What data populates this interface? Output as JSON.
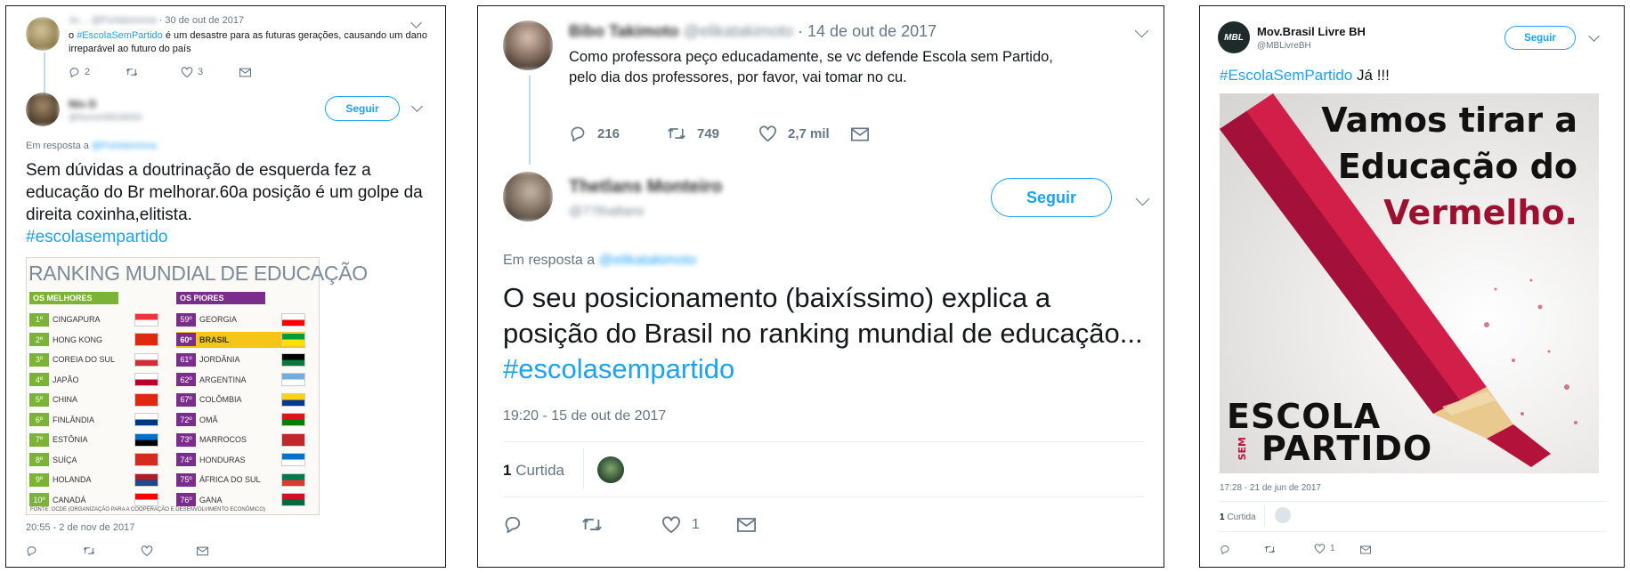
{
  "panel1": {
    "top_tweet": {
      "name": "Ju…",
      "handle": "@Fortalomnna",
      "date": "· 30 de out de 2017",
      "text_prefix": "o ",
      "hashtag": "#EscolaSemPartido",
      "text_suffix": " é um desastre para as futuras gerações, causando um dano irreparável ao futuro do país",
      "reply_count": "2",
      "like_count": "3"
    },
    "reply": {
      "name": "Nío D",
      "handle": "@NonoHMIO8000",
      "follow_label": "Seguir",
      "reply_prefix": "Em resposta a",
      "reply_to": "@Fortolomnna",
      "text": "Sem dúvidas a doutrinação de esquerda fez a educação do Br melhorar.60a posição é um golpe da direita coxinha,elitista.",
      "hashtag": "#escolasempartido",
      "timestamp": "20:55 - 2 de nov de 2017"
    },
    "ranking": {
      "title": "RANKING MUNDIAL DE EDUCAÇÃO",
      "best_label": "OS MELHORES",
      "worst_label": "OS PIORES",
      "best": [
        {
          "pos": "1º",
          "country": "CINGAPURA"
        },
        {
          "pos": "2º",
          "country": "HONG KONG"
        },
        {
          "pos": "3º",
          "country": "COREIA DO SUL"
        },
        {
          "pos": "4º",
          "country": "JAPÃO"
        },
        {
          "pos": "5º",
          "country": "CHINA"
        },
        {
          "pos": "6º",
          "country": "FINLÂNDIA"
        },
        {
          "pos": "7º",
          "country": "ESTÔNIA"
        },
        {
          "pos": "8º",
          "country": "SUÍÇA"
        },
        {
          "pos": "9º",
          "country": "HOLANDA"
        },
        {
          "pos": "10º",
          "country": "CANADÁ"
        }
      ],
      "worst": [
        {
          "pos": "59º",
          "country": "GEORGIA"
        },
        {
          "pos": "60º",
          "country": "BRASIL"
        },
        {
          "pos": "61º",
          "country": "JORDÂNIA"
        },
        {
          "pos": "62º",
          "country": "ARGENTINA"
        },
        {
          "pos": "67º",
          "country": "COLÔMBIA"
        },
        {
          "pos": "72º",
          "country": "OMÃ"
        },
        {
          "pos": "73º",
          "country": "MARROCOS"
        },
        {
          "pos": "74º",
          "country": "HONDURAS"
        },
        {
          "pos": "75º",
          "country": "ÁFRICA DO SUL"
        },
        {
          "pos": "76º",
          "country": "GANA"
        }
      ],
      "note": "FONTE: OCDE (ORGANIZAÇÃO PARA A COOPERAÇÃO E DESENVOLVIMENTO ECONÔMICO)"
    }
  },
  "panel2": {
    "top_tweet": {
      "name": "Bibo Takimoto",
      "handle": "@elikatakimoto",
      "date": "· 14 de out de 2017",
      "text": "Como professora peço educadamente, se vc defende Escola sem Partido, pelo dia dos professores, por favor, vai tomar no cu.",
      "reply_count": "216",
      "retweet_count": "749",
      "like_count": "2,7 mil"
    },
    "reply": {
      "name": "Thetlans Monteiro",
      "handle": "@77thatlans",
      "follow_label": "Seguir",
      "reply_prefix": "Em resposta a",
      "reply_to": "@elikatakimoto",
      "text": "O seu posicionamento (baixíssimo) explica a posição do Brasil no ranking mundial de educação...",
      "hashtag": "#escolasempartido",
      "timestamp": "19:20 - 15 de out de 2017",
      "likes_number": "1",
      "likes_label": "Curtida",
      "like_count": "1"
    }
  },
  "panel3": {
    "name": "Mov.Brasil Livre BH",
    "handle": "@MBLivreBH",
    "logo_text": "MBL",
    "follow_label": "Seguir",
    "hashtag": "#EscolaSemPartido",
    "text": " Já !!!",
    "image": {
      "line1": "Vamos tirar a",
      "line2": "Educação do",
      "line3": "Vermelho.",
      "brand_escola": "ESCOLA",
      "brand_sem": "SEM",
      "brand_partido": "PARTIDO"
    },
    "timestamp": "17:28 - 21 de jun de 2017",
    "likes_number": "1",
    "likes_label": "Curtida",
    "like_count": "1"
  },
  "colors": {
    "twitter_blue": "#1da1f2",
    "meta_grey": "#657786",
    "best_green": "#7ab335",
    "worst_purple": "#7b2d8c",
    "highlight_yellow": "#f5c518",
    "pencil_red": "#b3123a"
  }
}
